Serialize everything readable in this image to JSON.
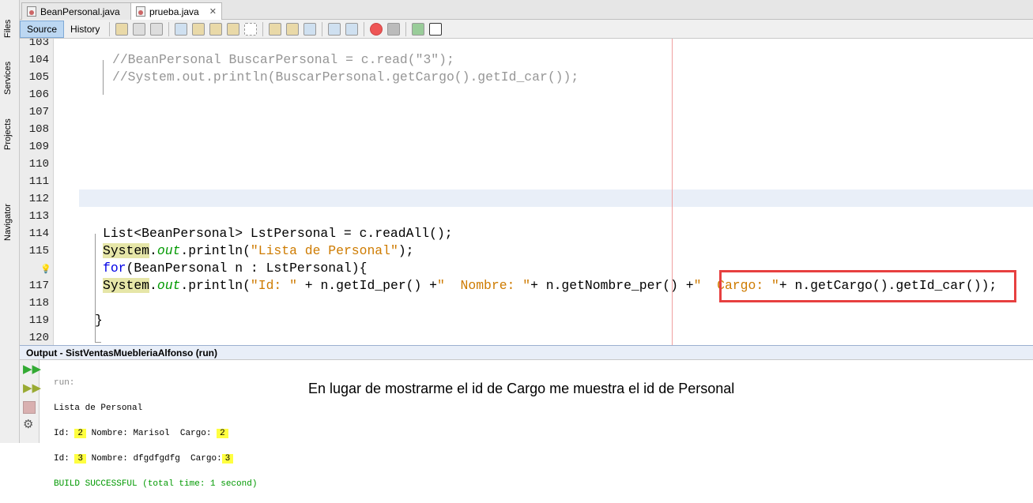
{
  "left_panels": [
    "Files",
    "Services",
    "Projects",
    "Navigator"
  ],
  "tabs": [
    {
      "label": "BeanPersonal.java",
      "close": "✕"
    },
    {
      "label": "prueba.java",
      "close": "✕"
    }
  ],
  "toolbar": {
    "source": "Source",
    "history": "History"
  },
  "editor": {
    "lines": [
      {
        "n": "103",
        "tokens": []
      },
      {
        "n": "104",
        "tokens": [
          {
            "t": "//BeanPersonal BuscarPersonal = c.read(\"3\");",
            "c": "cm"
          }
        ],
        "ind": 1
      },
      {
        "n": "105",
        "tokens": [
          {
            "t": "//System.out.println(BuscarPersonal.getCargo().getId_car());",
            "c": "cm"
          }
        ],
        "ind": 1
      },
      {
        "n": "106",
        "tokens": []
      },
      {
        "n": "107",
        "tokens": []
      },
      {
        "n": "108",
        "tokens": []
      },
      {
        "n": "109",
        "tokens": []
      },
      {
        "n": "110",
        "tokens": []
      },
      {
        "n": "111",
        "tokens": []
      },
      {
        "n": "112",
        "tokens": []
      },
      {
        "n": "113",
        "tokens": []
      },
      {
        "n": "114",
        "tokens": [
          {
            "t": "List<BeanPersonal> LstPersonal = c.readAll();",
            "c": ""
          }
        ]
      },
      {
        "n": "115",
        "tokens": [
          {
            "t": "System",
            "c": "hl"
          },
          {
            "t": ".",
            "c": ""
          },
          {
            "t": "out",
            "c": "fld"
          },
          {
            "t": ".println(",
            "c": ""
          },
          {
            "t": "\"Lista de Personal\"",
            "c": "str"
          },
          {
            "t": ");",
            "c": ""
          }
        ]
      },
      {
        "n": "",
        "hint": true,
        "tokens": [
          {
            "t": "for",
            "c": "kw"
          },
          {
            "t": "(BeanPersonal n : LstPersonal){",
            "c": ""
          }
        ]
      },
      {
        "n": "117",
        "tokens": [
          {
            "t": "System",
            "c": "hl"
          },
          {
            "t": ".",
            "c": ""
          },
          {
            "t": "out",
            "c": "fld"
          },
          {
            "t": ".println(",
            "c": ""
          },
          {
            "t": "\"Id: \"",
            "c": "str"
          },
          {
            "t": " + n.getId_per() +",
            "c": ""
          },
          {
            "t": "\"  Nombre: \"",
            "c": "str"
          },
          {
            "t": "+ n.getNombre_per() +",
            "c": ""
          },
          {
            "t": "\"  Cargo: \"",
            "c": "str"
          },
          {
            "t": "+ n.getCargo().getId_car());",
            "c": ""
          }
        ]
      },
      {
        "n": "118",
        "tokens": []
      },
      {
        "n": "119",
        "tokens": [
          {
            "t": "}",
            "c": ""
          }
        ],
        "ind": -1
      },
      {
        "n": "120",
        "tokens": []
      }
    ]
  },
  "colors": {
    "cm": "#969696",
    "str": "#ce7b00",
    "kw": "#0000e6",
    "fld": "#009900",
    "accent": "#e74040"
  },
  "output": {
    "title": "Output - SistVentasMuebleriaAlfonso (run)",
    "run": "run:",
    "l1": "Lista de Personal",
    "r1": {
      "a": "Id:",
      "id": "2",
      "b": "Nombre: Marisol  Cargo:",
      "cargo": "2"
    },
    "r2": {
      "a": "Id:",
      "id": "3",
      "b": "Nombre: dfgdfgdfg  Cargo:",
      "cargo": "3"
    },
    "build": "BUILD SUCCESSFUL (total time: 1 second)"
  },
  "note": "En lugar de mostrarme el id de Cargo me muestra el id de Personal"
}
